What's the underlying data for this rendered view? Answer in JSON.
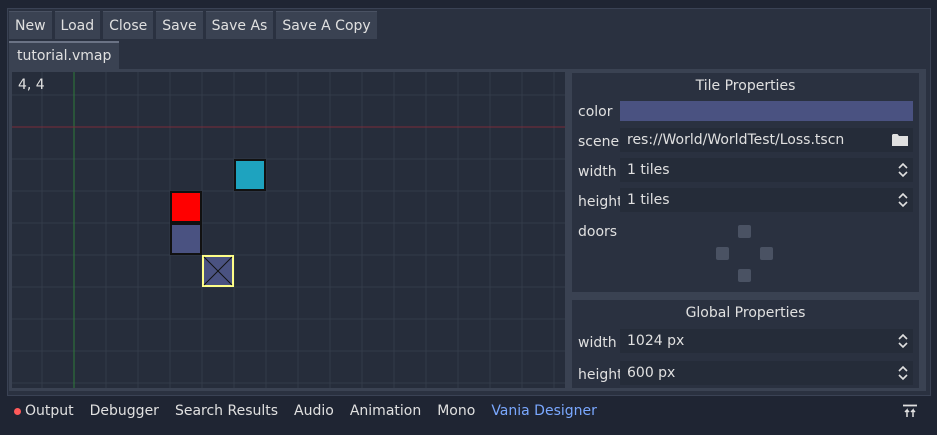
{
  "toolbar": {
    "new_label": "New",
    "load_label": "Load",
    "close_label": "Close",
    "save_label": "Save",
    "save_as_label": "Save As",
    "save_copy_label": "Save A Copy"
  },
  "file_tab": {
    "label": "tutorial.vmap"
  },
  "canvas": {
    "coordinates": "4, 4"
  },
  "tile_properties": {
    "title": "Tile Properties",
    "color_label": "color",
    "color_value": "#4a5281",
    "scene_label": "scene",
    "scene_value": "res://World/WorldTest/Loss.tscn",
    "width_label": "width",
    "width_value": "1 tiles",
    "height_label": "height",
    "height_value": "1 tiles",
    "doors_label": "doors"
  },
  "global_properties": {
    "title": "Global Properties",
    "width_label": "width",
    "width_value": "1024 px",
    "height_label": "height",
    "height_value": "600 px"
  },
  "bottom_tabs": {
    "output": "Output",
    "debugger": "Debugger",
    "search_results": "Search Results",
    "audio": "Audio",
    "animation": "Animation",
    "mono": "Mono",
    "vania_designer": "Vania Designer"
  },
  "colors": {
    "tile_red": "#ff0000",
    "tile_teal": "#1ea3bf",
    "tile_slate": "#4a5281",
    "selection": "#ffff88",
    "active_tab": "#7aa8ff",
    "output_dot": "#ff5a5a"
  }
}
